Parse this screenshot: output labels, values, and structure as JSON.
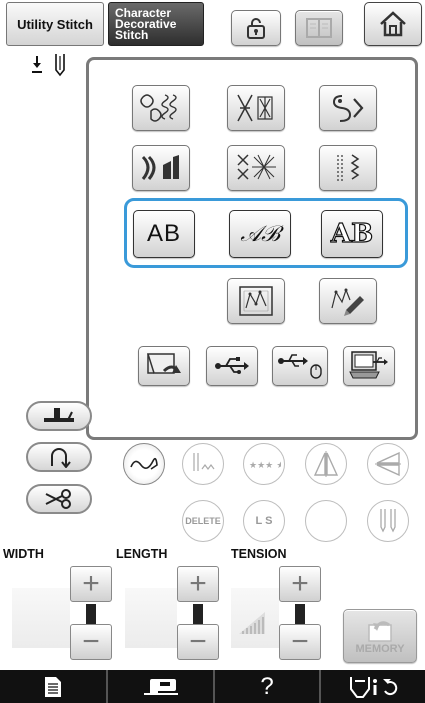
{
  "tabs": {
    "utility": "Utility Stitch",
    "character_line1": "Character",
    "character_line2": "Decorative",
    "character_line3": "Stitch"
  },
  "keys": {
    "ab": "AB",
    "script": "𝒜ℬ",
    "outline": "AB",
    "delete": "DELETE",
    "ls": "L S"
  },
  "labels": {
    "width": "WIDTH",
    "length": "LENGTH",
    "tension": "TENSION",
    "memory": "MEMORY"
  },
  "footer": {
    "help": "?"
  },
  "colors": {
    "highlight": "#3a9ad9",
    "footer_bg": "#111111"
  }
}
